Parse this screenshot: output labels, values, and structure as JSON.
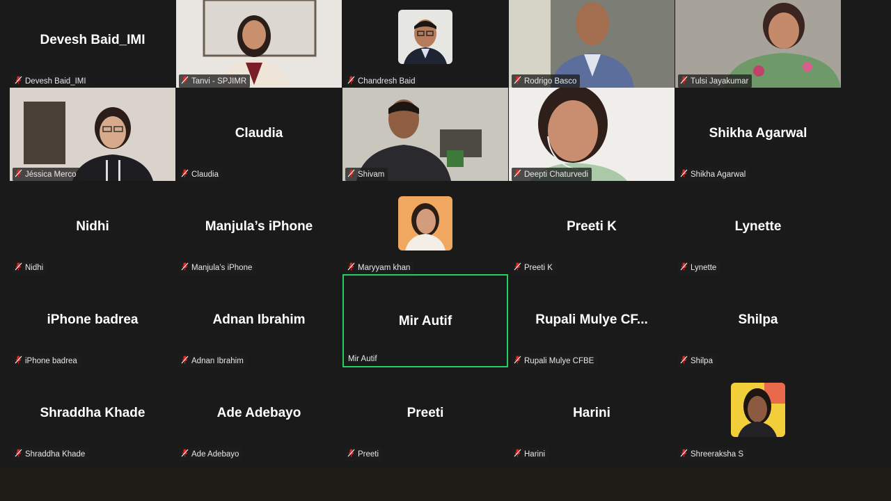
{
  "participants": [
    {
      "name": "Devesh Baid_IMI",
      "display": "Devesh Baid_IMI"
    },
    {
      "name": "Tanvi - SPJIMR",
      "video": "woman-light-top"
    },
    {
      "name": "Chandresh Baid",
      "avatar": "man-glasses-avatar"
    },
    {
      "name": "Rodrigo Basco",
      "video": "man-suit"
    },
    {
      "name": "Tulsi Jayakumar",
      "video": "woman-floral"
    },
    {
      "name": "Jéssica Merco",
      "video": "woman-glasses-dark"
    },
    {
      "name": "Claudia",
      "display": "Claudia"
    },
    {
      "name": "Shivam",
      "video": "man-office"
    },
    {
      "name": "Deepti Chaturvedi",
      "video": "woman-headset"
    },
    {
      "name": "Shikha Agarwal",
      "display": "Shikha Agarwal"
    },
    {
      "name": "Nidhi",
      "display": "Nidhi"
    },
    {
      "name": "Manjula’s iPhone",
      "display": "Manjula’s iPhone"
    },
    {
      "name": "Maryyam khan",
      "avatar": "woman-avatar-orange"
    },
    {
      "name": "Preeti K",
      "display": "Preeti K"
    },
    {
      "name": "Lynette",
      "display": "Lynette"
    },
    {
      "name": "iPhone badrea",
      "display": "iPhone badrea"
    },
    {
      "name": "Adnan Ibrahim",
      "display": "Adnan Ibrahim"
    },
    {
      "name": "Mir Autif",
      "display": "Mir Autif",
      "active": true
    },
    {
      "name": "Rupali Mulye CFBE",
      "display": "Rupali Mulye CF..."
    },
    {
      "name": "Shilpa",
      "display": "Shilpa"
    },
    {
      "name": "Shraddha Khade",
      "display": "Shraddha Khade"
    },
    {
      "name": "Ade Adebayo",
      "display": "Ade Adebayo"
    },
    {
      "name": "Preeti",
      "display": "Preeti"
    },
    {
      "name": "Harini",
      "display": "Harini"
    },
    {
      "name": "Shreeraksha S",
      "avatar": "woman-avatar-yellow"
    }
  ],
  "colors": {
    "background": "#1a1a1b",
    "active_speaker": "#23d160",
    "muted_icon": "#e02828"
  }
}
